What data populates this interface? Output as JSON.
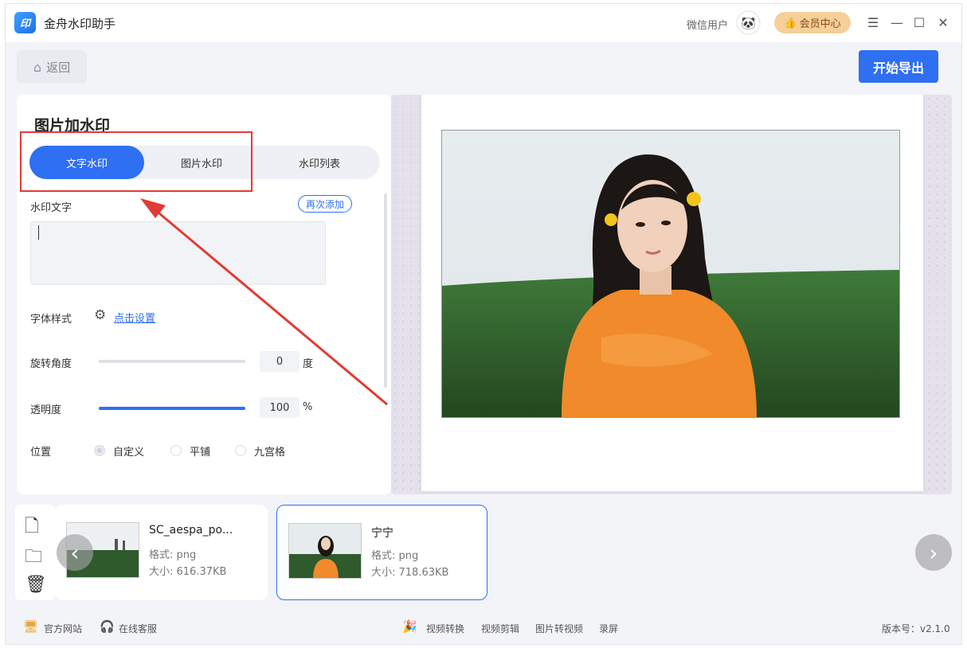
{
  "app": {
    "title": "金舟水印助手",
    "logo_text": "印",
    "user_name": "微信用户",
    "member_label": "会员中心"
  },
  "toolbar": {
    "back_label": "返回",
    "export_label": "开始导出"
  },
  "panel": {
    "title": "图片加水印",
    "tabs": [
      {
        "label": "文字水印",
        "active": true
      },
      {
        "label": "图片水印",
        "active": false
      },
      {
        "label": "水印列表",
        "active": false
      }
    ],
    "text_label": "水印文字",
    "readd_label": "再次添加",
    "text_value": "",
    "font_style_label": "字体样式",
    "font_style_link": "点击设置",
    "rotation_label": "旋转角度",
    "rotation_value": "0",
    "rotation_unit": "度",
    "opacity_label": "透明度",
    "opacity_value": "100",
    "opacity_unit": "%",
    "opacity_fraction": 1.0,
    "rotation_fraction": 0.0,
    "position_label": "位置",
    "position_options": [
      {
        "label": "自定义",
        "checked": true
      },
      {
        "label": "平铺",
        "checked": false
      },
      {
        "label": "九宫格",
        "checked": false
      }
    ]
  },
  "files": [
    {
      "name": "SC_aespa_po...",
      "format": "格式: png",
      "size": "大小: 616.37KB",
      "selected": false
    },
    {
      "name": "宁宁",
      "format": "格式: png",
      "size": "大小: 718.63KB",
      "selected": true
    }
  ],
  "footer": {
    "official_site": "官方网站",
    "online_service": "在线客服",
    "video_convert": "视频转换",
    "video_edit": "视频剪辑",
    "image_to_video": "图片转视频",
    "screen_record": "录屏",
    "version": "版本号：v2.1.0"
  },
  "colors": {
    "accent": "#2f6ff2",
    "highlight": "#e23b34",
    "member": "#f6cf9a"
  }
}
